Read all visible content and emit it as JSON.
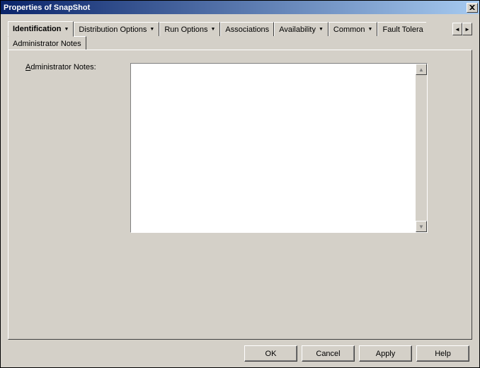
{
  "window": {
    "title": "Properties of SnapShot"
  },
  "tabs": {
    "row1": [
      {
        "label": "Identification",
        "active": true,
        "hasArrow": true
      },
      {
        "label": "Distribution Options",
        "hasArrow": true
      },
      {
        "label": "Run Options",
        "hasArrow": true
      },
      {
        "label": "Associations",
        "hasArrow": false
      },
      {
        "label": "Availability",
        "hasArrow": true
      },
      {
        "label": "Common",
        "hasArrow": true
      },
      {
        "label": "Fault Tolera",
        "hasArrow": false,
        "truncated": true
      }
    ],
    "row2": [
      {
        "label": "Administrator Notes",
        "hasArrow": false
      }
    ]
  },
  "form": {
    "notesLabel": "dministrator Notes:",
    "notesMnemonic": "A",
    "notesValue": ""
  },
  "buttons": {
    "ok": "OK",
    "cancel": "Cancel",
    "apply": "Apply",
    "help": "Help"
  }
}
